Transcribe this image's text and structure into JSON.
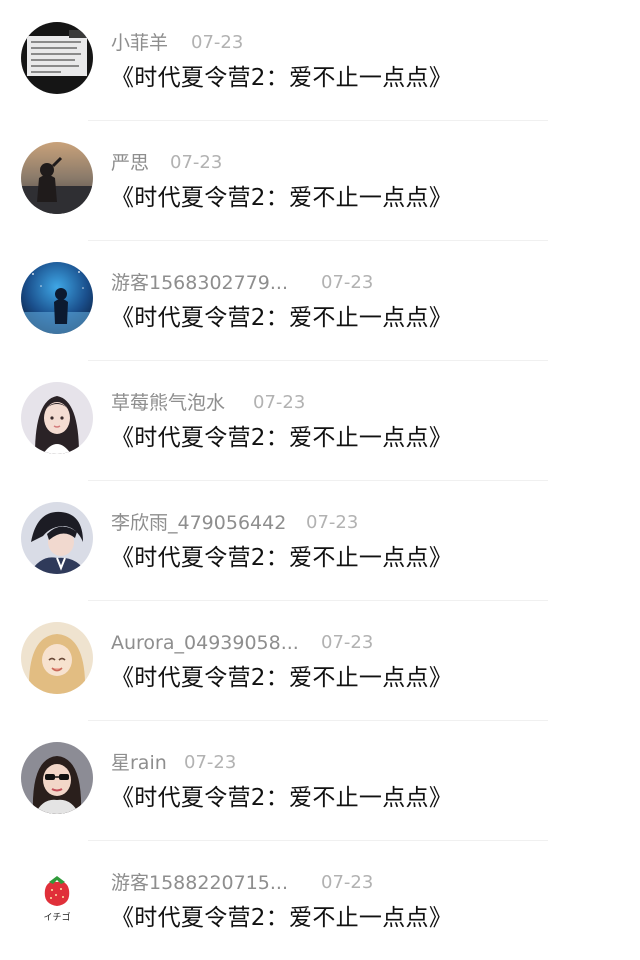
{
  "comments": [
    {
      "username": "小菲羊",
      "date": "07-23",
      "title": "《时代夏令营2：爱不止一点点》",
      "avatar": "text-note-avatar"
    },
    {
      "username": "严思",
      "date": "07-23",
      "title": "《时代夏令营2：爱不止一点点》",
      "avatar": "sunset-silhouette-avatar"
    },
    {
      "username": "游客1568302779...",
      "date": "07-23",
      "title": "《时代夏令营2：爱不止一点点》",
      "avatar": "night-sea-avatar"
    },
    {
      "username": "草莓熊气泡水",
      "date": "07-23",
      "title": "《时代夏令营2：爱不止一点点》",
      "avatar": "girl-portrait-avatar"
    },
    {
      "username": "李欣雨_479056442",
      "date": "07-23",
      "title": "《时代夏令营2：爱不止一点点》",
      "avatar": "anime-boy-avatar"
    },
    {
      "username": "Aurora_04939058...",
      "date": "07-23",
      "title": "《时代夏令营2：爱不止一点点》",
      "avatar": "anime-girl-blonde-avatar"
    },
    {
      "username": "星rain",
      "date": "07-23",
      "title": "《时代夏令营2：爱不止一点点》",
      "avatar": "sunglasses-girl-avatar"
    },
    {
      "username": "游客1588220715...",
      "date": "07-23",
      "title": "《时代夏令营2：爱不止一点点》",
      "avatar": "strawberry-avatar",
      "avatar_caption": "イチゴ"
    }
  ]
}
